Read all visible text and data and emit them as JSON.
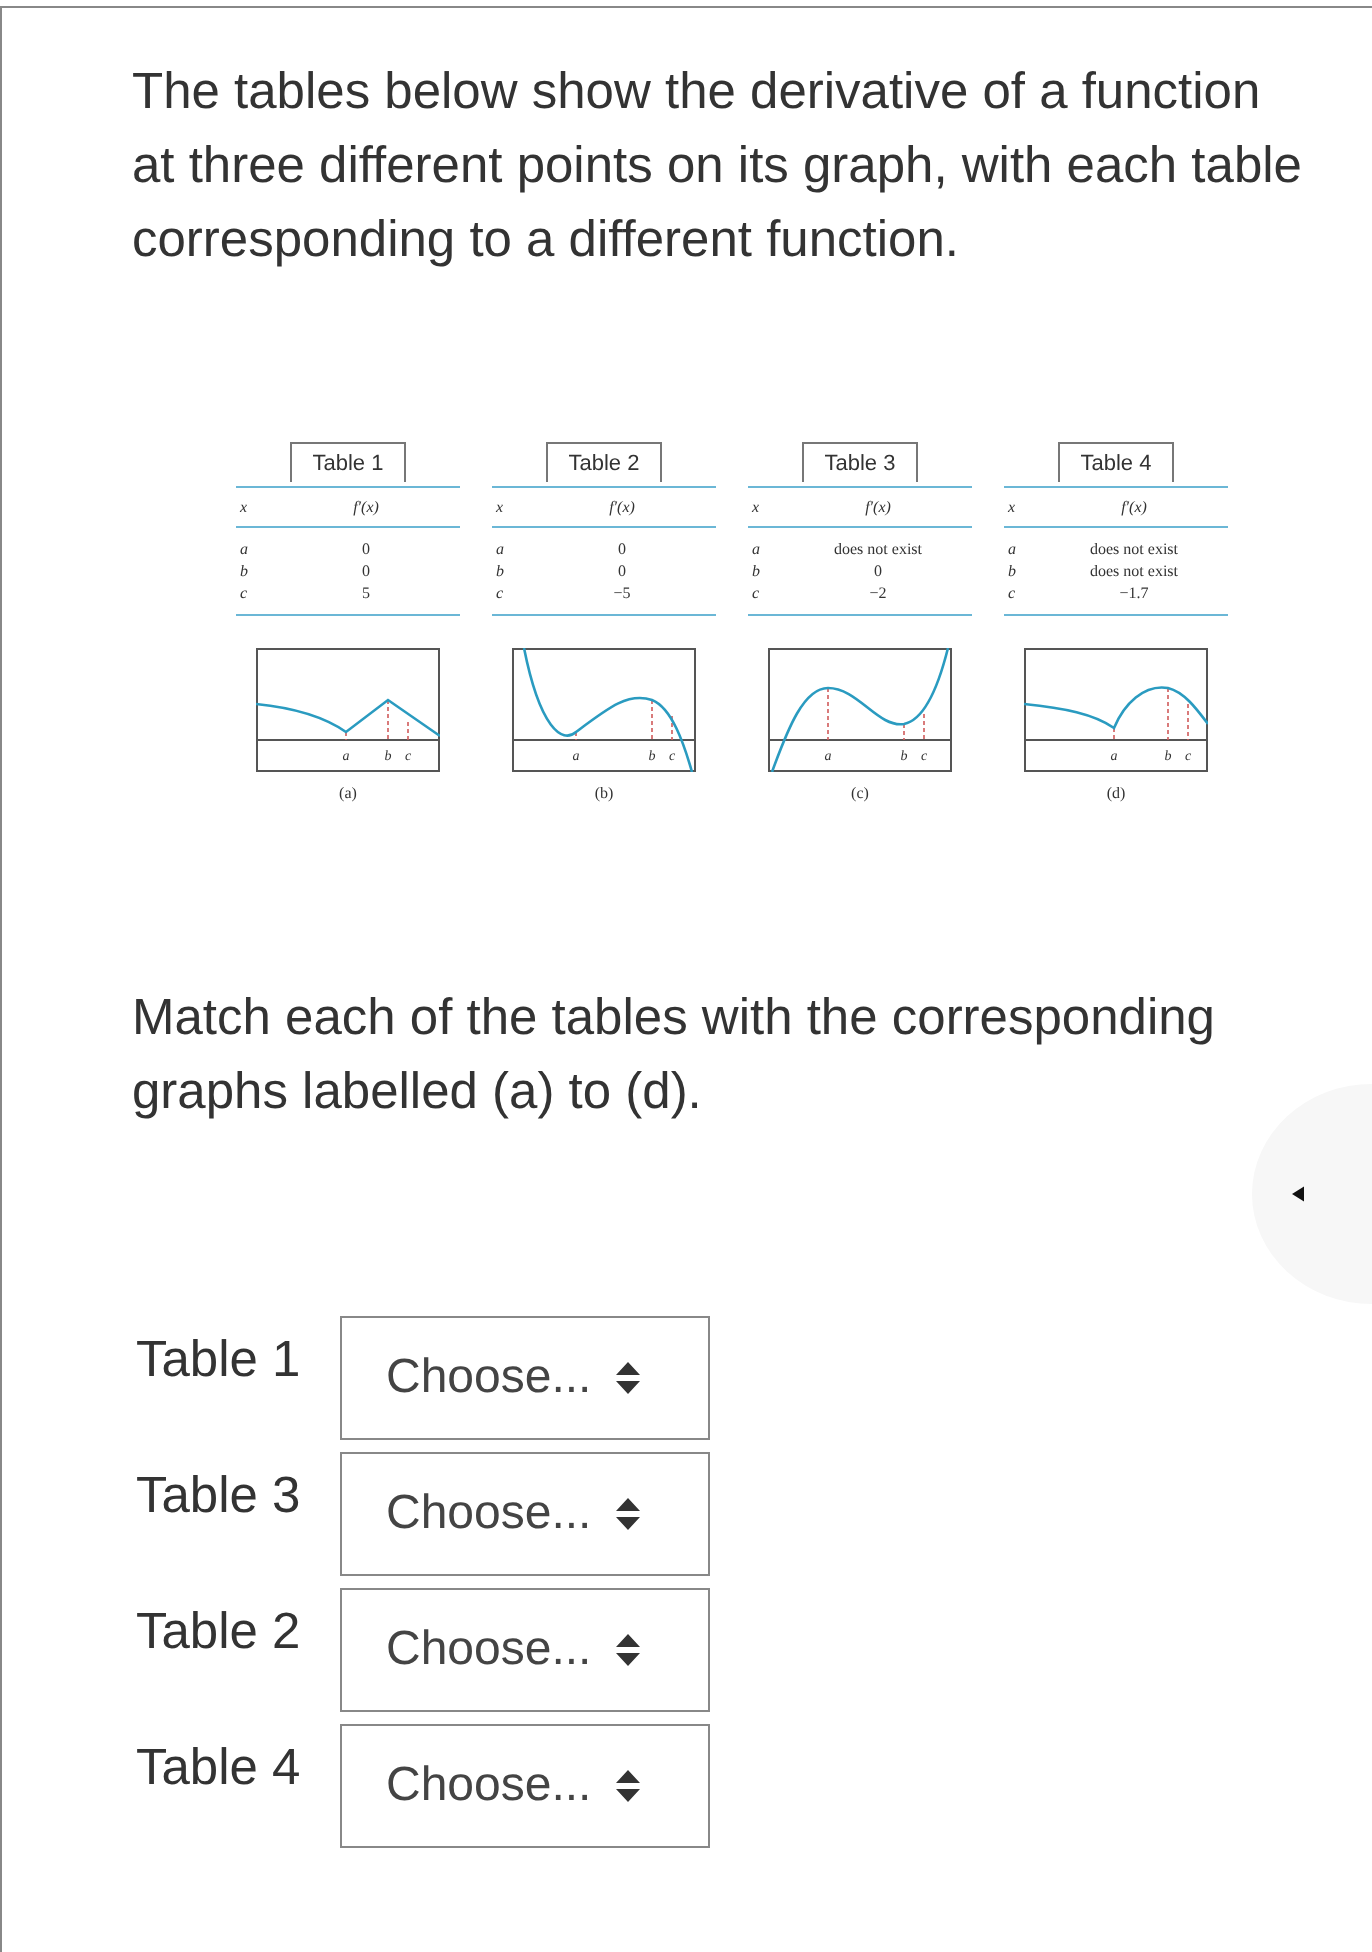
{
  "question": "The tables below show the derivative of a function at three different points on its graph, with each table corresponding to a different function.",
  "figure": {
    "columns": [
      {
        "table_title": "Table 1",
        "header": [
          "x",
          "f′(x)"
        ],
        "rows": [
          [
            "a",
            "0"
          ],
          [
            "b",
            "0"
          ],
          [
            "c",
            "5"
          ]
        ],
        "graph": {
          "kind": "corner",
          "axis_labels": [
            "a",
            "b",
            "c"
          ]
        },
        "caption": "(a)"
      },
      {
        "table_title": "Table 2",
        "header": [
          "x",
          "f′(x)"
        ],
        "rows": [
          [
            "a",
            "0"
          ],
          [
            "b",
            "0"
          ],
          [
            "c",
            "−5"
          ]
        ],
        "graph": {
          "kind": "falling",
          "axis_labels": [
            "a",
            "b",
            "c"
          ]
        },
        "caption": "(b)"
      },
      {
        "table_title": "Table 3",
        "header": [
          "x",
          "f′(x)"
        ],
        "rows": [
          [
            "a",
            "does not exist"
          ],
          [
            "b",
            "0"
          ],
          [
            "c",
            "−2"
          ]
        ],
        "graph": {
          "kind": "rising",
          "axis_labels": [
            "a",
            "b",
            "c"
          ]
        },
        "caption": "(c)"
      },
      {
        "table_title": "Table 4",
        "header": [
          "x",
          "f′(x)"
        ],
        "rows": [
          [
            "a",
            "does not exist"
          ],
          [
            "b",
            "does not exist"
          ],
          [
            "c",
            "−1.7"
          ]
        ],
        "graph": {
          "kind": "cusp",
          "axis_labels": [
            "a",
            "b",
            "c"
          ]
        },
        "caption": "(d)"
      }
    ]
  },
  "instruction": "Match each of the tables with the corresponding graphs labelled (a) to (d).",
  "matches": [
    {
      "label": "Table 1",
      "value": "Choose..."
    },
    {
      "label": "Table 3",
      "value": "Choose..."
    },
    {
      "label": "Table 2",
      "value": "Choose..."
    },
    {
      "label": "Table 4",
      "value": "Choose..."
    }
  ]
}
